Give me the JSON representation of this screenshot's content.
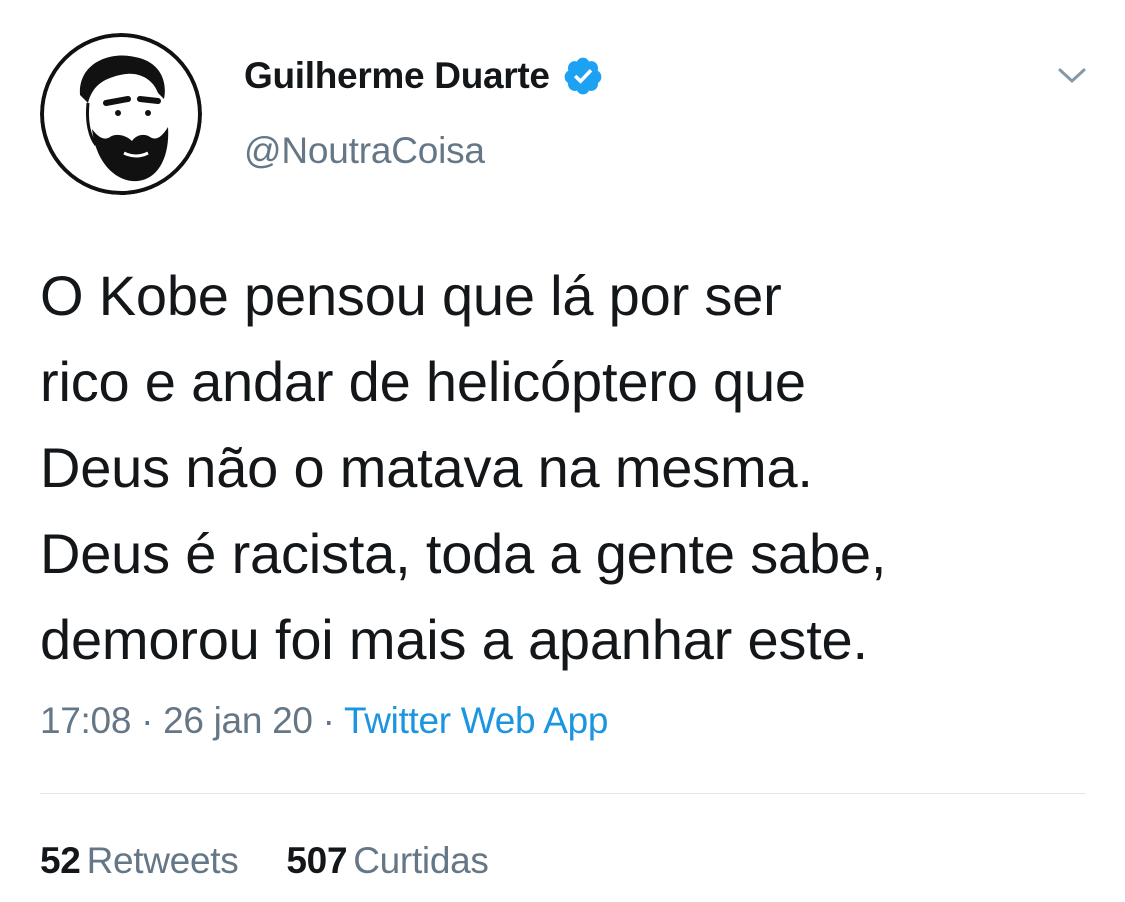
{
  "tweet": {
    "author": {
      "display_name": "Guilherme Duarte",
      "handle": "@NoutraCoisa",
      "verified_icon": "verified-badge-icon",
      "avatar_icon": "bearded-man-avatar"
    },
    "text_lines": [
      "O Kobe pensou que lá por ser",
      "rico e andar de helicóptero que",
      "Deus não o matava na mesma.",
      "Deus é racista, toda a gente sabe,",
      "demorou foi mais a apanhar este."
    ],
    "meta": {
      "time": "17:08",
      "separator": "·",
      "date": "26 jan 20",
      "source": "Twitter Web App"
    },
    "stats": {
      "retweets_count": "52",
      "retweets_label": "Retweets",
      "likes_count": "507",
      "likes_label": "Curtidas"
    }
  },
  "colors": {
    "primary_text": "#14171a",
    "secondary_text": "#657786",
    "link": "#1b95e0",
    "verified": "#1da1f2",
    "divider": "#e1e8ed"
  }
}
